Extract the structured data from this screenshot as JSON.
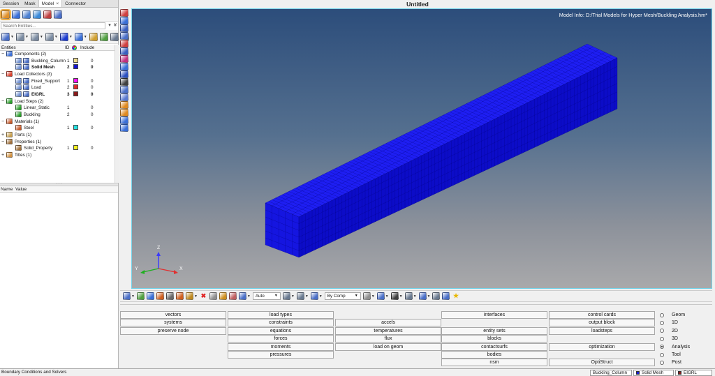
{
  "window": {
    "title": "Untitled"
  },
  "left_panel": {
    "tabs": [
      {
        "label": "Session"
      },
      {
        "label": "Mask"
      },
      {
        "label": "Model",
        "close": "×"
      },
      {
        "label": "Connector"
      }
    ],
    "toolbar1": [
      {
        "icon": "display-icon",
        "color": "#e0902a",
        "active": true
      },
      {
        "icon": "mask-icon",
        "color": "#3a6fd8"
      },
      {
        "icon": "organize-icon",
        "color": "#4a7fd0"
      },
      {
        "icon": "find-icon",
        "color": "#3a8ad8"
      },
      {
        "icon": "reorder-icon",
        "color": "#c04040"
      },
      {
        "icon": "renumber-icon",
        "color": "#4a6fc8"
      }
    ],
    "search": {
      "placeholder": "Search Entities..."
    },
    "toolbar2": [
      {
        "icon": "entity-type-icon",
        "color": "#4a6fc8",
        "menu": true
      },
      {
        "icon": "show-icon",
        "color": "#7a8aa0",
        "menu": true
      },
      {
        "icon": "show-all-icon",
        "color": "#7a8aa0",
        "menu": true
      },
      {
        "icon": "isolate-icon",
        "color": "#7a8aa0",
        "menu": true
      },
      {
        "icon": "ball-icon",
        "color": "#1a3ad0",
        "menu": true
      },
      {
        "icon": "collectors-icon",
        "color": "#3a6fd8",
        "menu": true
      },
      {
        "icon": "cursor-icon",
        "color": "#d0a030"
      },
      {
        "icon": "import-icon",
        "color": "#50a040"
      },
      {
        "icon": "eye-icon",
        "color": "#6a7a90"
      },
      {
        "icon": "eye-plus-icon",
        "color": "#6a7a90"
      }
    ],
    "columns": {
      "entities": "Entities",
      "id": "ID",
      "include": "Include"
    },
    "tree": [
      {
        "label": "Components (2)",
        "level": 0,
        "expander": "−",
        "icons": [
          {
            "icon": "components-folder-icon",
            "color": "#3a6fd8"
          }
        ]
      },
      {
        "label": "Buckling_Column",
        "level": 1,
        "icons": [
          {
            "icon": "visibility-icon",
            "color": "#6f8fd0"
          },
          {
            "icon": "component-icon",
            "color": "#4a6fc8"
          }
        ],
        "id": "1",
        "color": "#ecd98a",
        "include": "0"
      },
      {
        "label": "Solid Mesh",
        "level": 1,
        "icons": [
          {
            "icon": "visibility-icon",
            "color": "#6f8fd0"
          },
          {
            "icon": "component-icon",
            "color": "#4a6fc8"
          }
        ],
        "id": "2",
        "color": "#1414d0",
        "include": "0",
        "bold": true
      },
      {
        "label": "Load Collectors (3)",
        "level": 0,
        "expander": "−",
        "icons": [
          {
            "icon": "load-collectors-folder-icon",
            "color": "#d8402c"
          }
        ]
      },
      {
        "label": "Fixed_Support",
        "level": 1,
        "icons": [
          {
            "icon": "visibility-icon",
            "color": "#6f8fd0"
          },
          {
            "icon": "load-collector-icon",
            "color": "#4a6fc8"
          }
        ],
        "id": "1",
        "color": "#ff10ff",
        "include": "0"
      },
      {
        "label": "Load",
        "level": 1,
        "icons": [
          {
            "icon": "visibility-icon",
            "color": "#6f8fd0"
          },
          {
            "icon": "load-collector-icon",
            "color": "#4a6fc8"
          }
        ],
        "id": "2",
        "color": "#e02a2a",
        "include": "0"
      },
      {
        "label": "EIGRL",
        "level": 1,
        "icons": [
          {
            "icon": "visibility-icon",
            "color": "#6f8fd0"
          },
          {
            "icon": "load-collector-icon",
            "color": "#4a6fc8"
          }
        ],
        "id": "3",
        "color": "#8b1a1a",
        "include": "0",
        "bold": true
      },
      {
        "label": "Load Steps (2)",
        "level": 0,
        "expander": "−",
        "icons": [
          {
            "icon": "loadsteps-folder-icon",
            "color": "#2aa02a"
          }
        ]
      },
      {
        "label": "Linear_Static",
        "level": 1,
        "icons": [
          {
            "icon": "loadstep-icon",
            "color": "#2aa02a"
          }
        ],
        "id": "1",
        "include": "0"
      },
      {
        "label": "Buckling",
        "level": 1,
        "icons": [
          {
            "icon": "loadstep-icon",
            "color": "#2aa02a"
          }
        ],
        "id": "2",
        "include": "0"
      },
      {
        "label": "Materials (1)",
        "level": 0,
        "expander": "−",
        "icons": [
          {
            "icon": "materials-folder-icon",
            "color": "#c85a2a"
          }
        ]
      },
      {
        "label": "Steel",
        "level": 1,
        "icons": [
          {
            "icon": "material-icon",
            "color": "#c85a2a"
          }
        ],
        "id": "1",
        "color": "#22e0e0",
        "include": "0"
      },
      {
        "label": "Parts (1)",
        "level": 0,
        "expander": "+",
        "icons": [
          {
            "icon": "parts-folder-icon",
            "color": "#c8a050"
          }
        ]
      },
      {
        "label": "Properties (1)",
        "level": 0,
        "expander": "−",
        "icons": [
          {
            "icon": "properties-folder-icon",
            "color": "#a0703a"
          }
        ]
      },
      {
        "label": "Solid_Property",
        "level": 1,
        "icons": [
          {
            "icon": "property-icon",
            "color": "#a0703a"
          }
        ],
        "id": "1",
        "color": "#f4f01e",
        "include": "0"
      },
      {
        "label": "Titles (1)",
        "level": 0,
        "expander": "+",
        "icons": [
          {
            "icon": "titles-folder-icon",
            "color": "#d09040"
          }
        ]
      }
    ],
    "props_header": {
      "name": "Name",
      "value": "Value"
    }
  },
  "vertical_toolbar": [
    {
      "icon": "component-display-icon",
      "color": "#d04040"
    },
    {
      "icon": "mask-element-icon",
      "color": "#3a6fd8"
    },
    {
      "icon": "shaded-icon",
      "color": "#3a5fc0"
    },
    {
      "icon": "wireframe-icon",
      "color": "#4a6fc8"
    },
    {
      "icon": "transparency-icon",
      "color": "#d04040"
    },
    {
      "icon": "mesh-lines-icon",
      "color": "#3a5fc0"
    },
    {
      "icon": "element-color-icon",
      "color": "#c03080"
    },
    {
      "icon": "free-edges-icon",
      "color": "#3a6fd8"
    },
    {
      "icon": "info-icon",
      "color": "#2a4fc0"
    },
    {
      "icon": "numbers-icon",
      "color": "#404040"
    },
    {
      "icon": "normals-icon",
      "color": "#4a6fc8"
    },
    {
      "icon": "quality-icon",
      "color": "#5a7ad0"
    },
    {
      "icon": "label-icon",
      "color": "#e08a20"
    },
    {
      "icon": "abc-label-icon",
      "color": "#e08a20"
    },
    {
      "icon": "shrink-icon",
      "color": "#3a6fd8"
    },
    {
      "icon": "reflect-icon",
      "color": "#3a6fd8"
    }
  ],
  "graphics": {
    "model_info": "Model Info: D:/Trial Models for Hyper Mesh/Buckling Analysis.hm*",
    "axes": {
      "z": "Z",
      "y": "Y",
      "x": "X"
    }
  },
  "bottom_toolbar": [
    {
      "icon": "view-icon",
      "color": "#4a6fc8",
      "menu": true
    },
    {
      "icon": "mask-select-icon",
      "color": "#50a040"
    },
    {
      "icon": "unmask-icon",
      "color": "#3a6fd8"
    },
    {
      "icon": "reverse-icon",
      "color": "#d06020"
    },
    {
      "icon": "mask-adjacent-icon",
      "color": "#6a6a6a"
    },
    {
      "icon": "unmask-all-icon",
      "color": "#d06020"
    },
    {
      "icon": "find-attached-icon",
      "color": "#c08a20",
      "menu": true
    },
    {
      "icon": "delete-icon",
      "color": "#e02020"
    },
    {
      "icon": "hide-icon",
      "color": "#909090"
    },
    {
      "icon": "isolate-only-icon",
      "color": "#d09020"
    },
    {
      "icon": "show-pick-icon",
      "color": "#c06060"
    },
    {
      "icon": "connectors-icon",
      "color": "#4a6fc8",
      "menu": true
    },
    {
      "select": "Auto"
    },
    {
      "icon": "rotate-icon",
      "color": "#6a7a90",
      "menu": true
    },
    {
      "icon": "pan-icon",
      "color": "#6a7a90",
      "menu": true
    },
    {
      "icon": "fit-icon",
      "color": "#4a6fc8",
      "menu": true
    },
    {
      "select": "By Comp"
    },
    {
      "icon": "mesh-display-icon",
      "color": "#909090",
      "menu": true
    },
    {
      "icon": "solid-display-icon",
      "color": "#4a6fc8",
      "menu": true
    },
    {
      "icon": "line-display-icon",
      "color": "#404040",
      "menu": true
    },
    {
      "icon": "surface-display-icon",
      "color": "#6a7a90",
      "menu": true
    },
    {
      "icon": "element-display-icon",
      "color": "#4a6fc8",
      "menu": true
    },
    {
      "icon": "lighting-icon",
      "color": "#6a7a90"
    },
    {
      "icon": "screen-icon",
      "color": "#4a6fc8"
    },
    {
      "icon": "star-icon",
      "color": "#e8b800"
    }
  ],
  "panel": {
    "columns": [
      [
        "vectors",
        "systems",
        "preserve node",
        null,
        null,
        null,
        null
      ],
      [
        "load types",
        "constraints",
        "equations",
        "forces",
        "moments",
        "pressures",
        null
      ],
      [
        null,
        "accels",
        "temperatures",
        "flux",
        "load on geom",
        null,
        null
      ],
      [
        "interfaces",
        null,
        "entity sets",
        "blocks",
        "contactsurfs",
        "bodies",
        "nsm"
      ],
      [
        "control cards",
        "output block",
        "loadsteps",
        null,
        "optimization",
        null,
        "OptiStruct"
      ]
    ],
    "modes": [
      "Geom",
      "1D",
      "2D",
      "3D",
      "Analysis",
      "Tool",
      "Post"
    ],
    "selected_mode": "Analysis"
  },
  "status": {
    "message": "Boundary Conditions and Solvers",
    "fields": [
      {
        "label": "Buckling_Column"
      },
      {
        "label": "Solid Mesh",
        "color": "#1a1ad8"
      },
      {
        "label": "EIGRL",
        "color": "#8b1a1a"
      }
    ]
  }
}
